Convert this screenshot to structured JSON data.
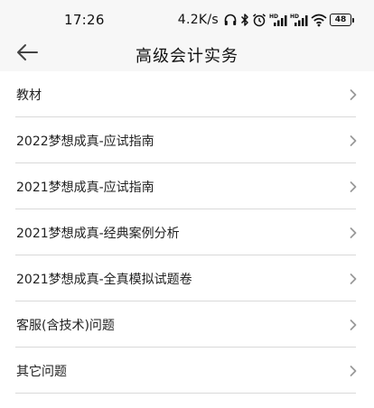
{
  "status_bar": {
    "time": "17:26",
    "network_speed": "4.2K/s",
    "battery": "48",
    "icons": [
      "headphones-icon",
      "bluetooth-icon",
      "alarm-icon",
      "hd-signal-icon",
      "hd-signal-icon",
      "wifi-icon",
      "battery-icon"
    ]
  },
  "header": {
    "back_icon": "arrow-left-icon",
    "title": "高级会计实务"
  },
  "menu": {
    "items": [
      {
        "label": "教材"
      },
      {
        "label": "2022梦想成真-应试指南"
      },
      {
        "label": "2021梦想成真-应试指南"
      },
      {
        "label": "2021梦想成真-经典案例分析"
      },
      {
        "label": "2021梦想成真-全真模拟试题卷"
      },
      {
        "label": "客服(含技术)问题"
      },
      {
        "label": "其它问题"
      }
    ],
    "chevron_icon": "chevron-right-icon"
  },
  "colors": {
    "header_background": "#f7f7f7",
    "background": "#ffffff",
    "divider": "#d9d9d9",
    "chevron": "#9a9a9a",
    "text": "#222222"
  }
}
